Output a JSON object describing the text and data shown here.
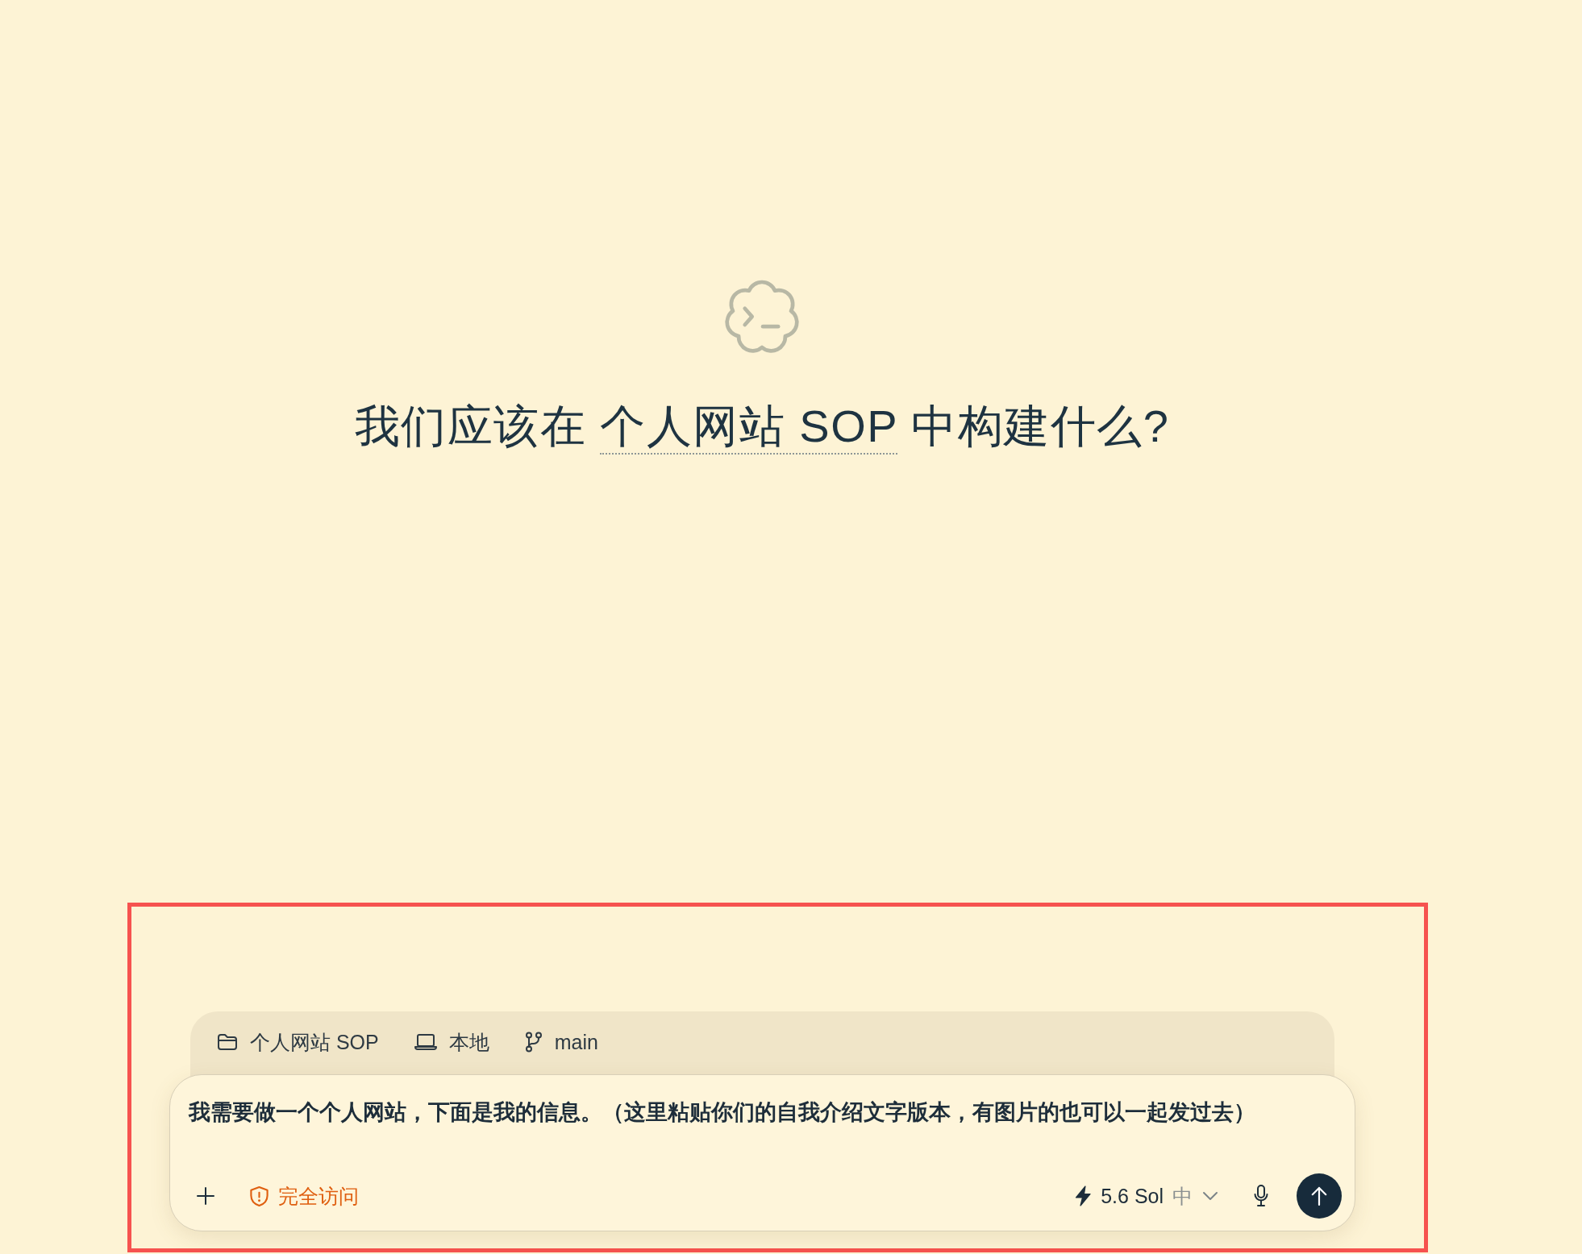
{
  "heading": {
    "before": "我们应该在",
    "project_link": "个人网站 SOP",
    "after": "中构建什么?"
  },
  "context_bar": {
    "items": [
      {
        "kind": "folder",
        "label": "个人网站 SOP"
      },
      {
        "kind": "environment",
        "label": "本地"
      },
      {
        "kind": "branch",
        "label": "main"
      }
    ]
  },
  "composer": {
    "value": "我需要做一个个人网站，下面是我的信息。（这里粘贴你们的自我介绍文字版本，有图片的也可以一起发过去）",
    "access_mode": "完全访问",
    "model": "5.6 Sol",
    "reasoning_effort": "中"
  }
}
